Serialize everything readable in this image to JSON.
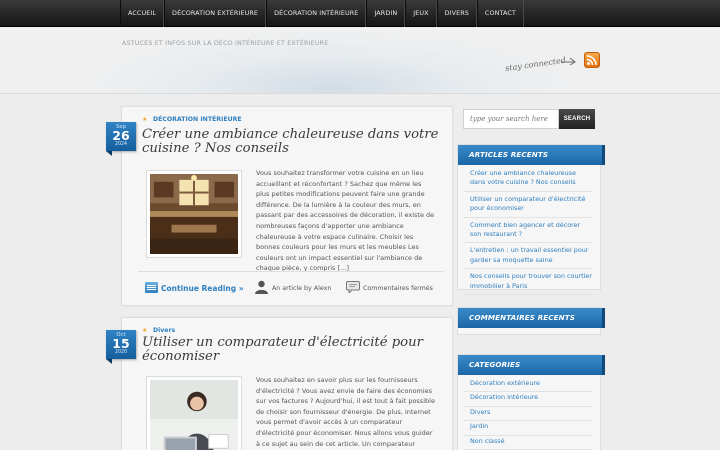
{
  "nav": {
    "items": [
      "ACCUEIL",
      "DÉCORATION EXTÉRIEURE",
      "DÉCORATION INTÉRIEURE",
      "JARDIN",
      "JEUX",
      "DIVERS",
      "CONTACT"
    ]
  },
  "header": {
    "tagline": "ASTUCES ET INFOS SUR LA DÉCO INTÉRIEURE ET EXTÉRIEURE",
    "stay_connected": "stay connected"
  },
  "posts": [
    {
      "date": {
        "month": "Sep",
        "day": "26",
        "year": "2024"
      },
      "category": "DÉCORATION INTÉRIEURE",
      "title": "Créer une ambiance chaleureuse dans votre cuisine ? Nos conseils",
      "excerpt": "Vous souhaitez transformer votre cuisine en un lieu accueillant et réconfortant ? Sachez que même les plus petites modifications peuvent faire une grande différence. De la lumière à la couleur des murs, en passant par des accessoires de décoration, il existe de nombreuses façons d'apporter une ambiance chaleureuse à votre espace culinaire. Choisir les bonnes couleurs pour les murs et les meubles Les couleurs ont un impact essentiel sur l'ambiance de chaque pièce, y compris […]",
      "more": "Continue Reading »",
      "author": "An article by Alexn",
      "comments": "Commentaires fermés"
    },
    {
      "date": {
        "month": "Oct",
        "day": "15",
        "year": "2020"
      },
      "category": "Divers",
      "title": "Utiliser un comparateur d'électricité pour économiser",
      "excerpt": "Vous souhaitez en savoir plus sur les fournisseurs d'électricité ? Vous avez envie de faire des économies sur vos factures ? Aujourd'hui, il est tout à fait possible de choisir son fournisseur d'énergie. De plus, internet vous permet d'avoir accès à un comparateur d'électricité pour économiser. Nous allons vous guider à ce sujet au sein de cet article. Un comparateur d'énergie : qu'est ce que c'est ?"
    }
  ],
  "sidebar": {
    "search_placeholder": "type your search here",
    "search_button": "SEARCH",
    "recent_title": "ARTICLES RECENTS",
    "recent": [
      "Créer une ambiance chaleureuse dans votre cuisine ? Nos conseils",
      "Utiliser un comparateur d'électricité pour économiser",
      "Comment bien agencer et décorer son restaurant ?",
      "L'entretien : un travail essentiel pour garder sa moquette saine",
      "Nos conseils pour trouver son courtier immobilier à Paris"
    ],
    "comments_title": "COMMENTAIRES RECENTS",
    "categories_title": "CATEGORIES",
    "categories": [
      "Décoration extérieure",
      "Décoration intérieure",
      "Divers",
      "Jardin",
      "Non classé"
    ]
  },
  "colors": {
    "accent": "#2f7fc0",
    "header_bar": "#1a66a6",
    "nav": "#222222",
    "rss": "#e8861f"
  }
}
